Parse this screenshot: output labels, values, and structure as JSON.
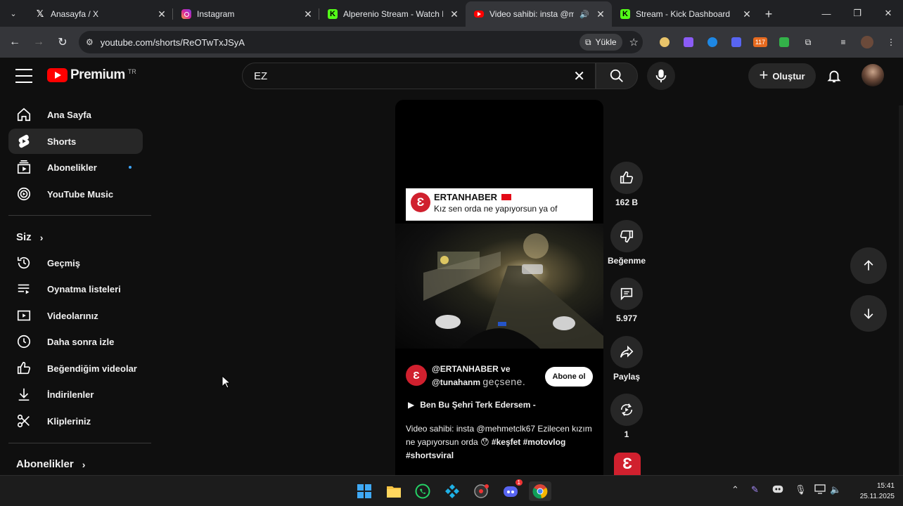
{
  "browser": {
    "tabs": [
      {
        "title": "Anasayfa / X",
        "icon": "x-logo-icon"
      },
      {
        "title": "Instagram",
        "icon": "instagram-icon"
      },
      {
        "title": "Alperenio Stream - Watch Li",
        "icon": "kick-icon"
      },
      {
        "title": "Video sahibi: insta @me",
        "icon": "youtube-icon"
      },
      {
        "title": "Stream - Kick Dashboard",
        "icon": "kick-icon"
      }
    ],
    "url": "youtube.com/shorts/ReOTwTxJSyA",
    "upload_label": "Yükle",
    "extension_badge": "117"
  },
  "masthead": {
    "logo_text": "Premium",
    "logo_region": "TR",
    "search_value": "EZ",
    "create_label": "Oluştur"
  },
  "sidebar": {
    "main_items": [
      {
        "label": "Ana Sayfa",
        "icon": "home-icon"
      },
      {
        "label": "Shorts",
        "icon": "shorts-icon"
      },
      {
        "label": "Abonelikler",
        "icon": "subscriptions-icon"
      },
      {
        "label": "YouTube Music",
        "icon": "youtube-music-icon"
      }
    ],
    "you_header": "Siz",
    "you_items": [
      {
        "label": "Geçmiş",
        "icon": "history-icon"
      },
      {
        "label": "Oynatma listeleri",
        "icon": "playlists-icon"
      },
      {
        "label": "Videolarınız",
        "icon": "your-videos-icon"
      },
      {
        "label": "Daha sonra izle",
        "icon": "watch-later-icon"
      },
      {
        "label": "Beğendiğim videolar",
        "icon": "liked-videos-icon"
      },
      {
        "label": "İndirilenler",
        "icon": "downloads-icon"
      },
      {
        "label": "Klipleriniz",
        "icon": "clips-icon"
      }
    ],
    "subscriptions_header": "Abonelikler"
  },
  "short": {
    "overlay_brand": "ERTANHABER",
    "overlay_caption": "Kız sen orda ne yapıyorsun ya of",
    "channel_line1": "@ERTANHABER ve",
    "channel_line2": "@tunahanm",
    "channel_overlay": "geçsene.",
    "subscribe_label": "Abone ol",
    "music_label": "Ben Bu Şehri Terk Edersem -",
    "description_text": "Video sahibi: insta @mehmetclk67 Ezilecen kızım ne yapıyorsun orda 😯",
    "hashtags": "#keşfet #motovlog #shortsviral"
  },
  "actions": {
    "likes": "162 B",
    "dislike_label": "Beğenme",
    "comments": "5.977",
    "share_label": "Paylaş",
    "remix_count": "1"
  },
  "taskbar": {
    "time": "15:41",
    "date": "25.11.2025",
    "discord_badge": "1"
  }
}
